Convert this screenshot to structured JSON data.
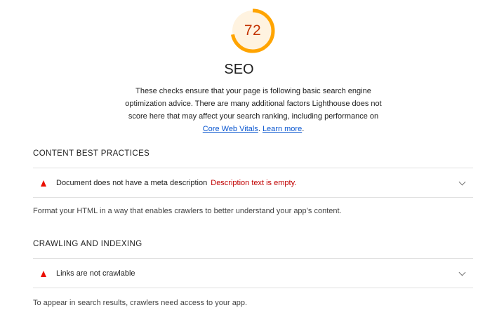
{
  "score": {
    "value": "72",
    "fraction": 0.72,
    "color": "#ffa400",
    "text_color": "#c33300",
    "title": "SEO",
    "description": "These checks ensure that your page is following basic search engine optimization advice. There are many additional factors Lighthouse does not score here that may affect your search ranking, including performance on",
    "link1_label": "Core Web Vitals",
    "separator": ".",
    "link2_label": "Learn more",
    "end": "."
  },
  "groups": [
    {
      "title": "CONTENT BEST PRACTICES",
      "audits": [
        {
          "title": "Document does not have a meta description",
          "display_value": "Description text is empty.",
          "status_icon": "fail-triangle-icon",
          "expand_icon": "chevron-down-icon"
        }
      ],
      "description": "Format your HTML in a way that enables crawlers to better understand your app’s content."
    },
    {
      "title": "CRAWLING AND INDEXING",
      "audits": [
        {
          "title": "Links are not crawlable",
          "display_value": "",
          "status_icon": "fail-triangle-icon",
          "expand_icon": "chevron-down-icon"
        }
      ],
      "description": "To appear in search results, crawlers need access to your app."
    }
  ],
  "colors": {
    "fail": "#eb0f00",
    "fail_text": "#c00000",
    "average": "#ffa400",
    "link": "#0b57d0"
  }
}
